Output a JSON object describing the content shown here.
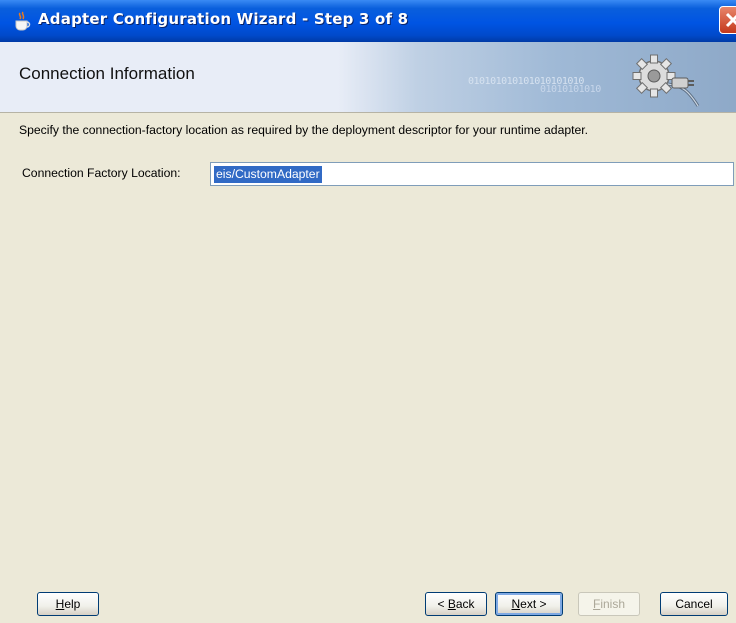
{
  "window": {
    "title": "Adapter Configuration Wizard - Step 3 of 8"
  },
  "header": {
    "title": "Connection Information",
    "binary_text_1": "010101010101010101010",
    "binary_text_2": "01010101010"
  },
  "main": {
    "description": "Specify the connection-factory location as required by the deployment descriptor for your runtime adapter.",
    "connection_factory_label": "Connection Factory Location:",
    "connection_factory_value": "eis/CustomAdapter"
  },
  "buttons": {
    "help": {
      "prefix": "",
      "mnemonic": "H",
      "suffix": "elp"
    },
    "back": {
      "prefix": "< ",
      "mnemonic": "B",
      "suffix": "ack"
    },
    "next": {
      "prefix": "",
      "mnemonic": "N",
      "suffix": "ext >"
    },
    "finish": {
      "prefix": "",
      "mnemonic": "F",
      "suffix": "inish"
    },
    "cancel": {
      "label": "Cancel"
    }
  },
  "colors": {
    "titlebar": "#0054e3",
    "selection": "#316ac5",
    "dialog_bg": "#ece9d8"
  }
}
